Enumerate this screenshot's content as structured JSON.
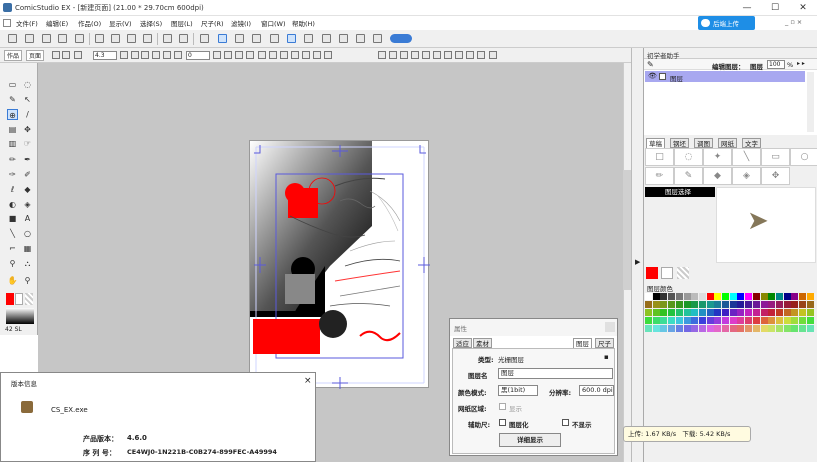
{
  "window": {
    "title": "ComicStudio EX - [新建页面] (21.00 * 29.70cm 600dpi)",
    "minimize": "—",
    "maximize": "☐",
    "close": "✕",
    "doc_restore": "_ ▫ ×"
  },
  "menu": [
    "文件(F)",
    "编辑(E)",
    "作品(O)",
    "显示(V)",
    "选择(S)",
    "图层(L)",
    "尺子(R)",
    "滤镜(I)",
    "窗口(W)",
    "帮助(H)"
  ],
  "upload_button": "后端上传",
  "toolbar2": {
    "tab1": "作品",
    "tab2": "页面",
    "zoom_value": "4.3",
    "angle_value": "0"
  },
  "tool_palette": {
    "status": "42",
    "status_unit": "SL"
  },
  "layer_panel": {
    "title": "初学者助手",
    "edit_label": "编辑图层：",
    "edit_layer": "图层",
    "opacity": "100",
    "opacity_unit": "%",
    "layer_name": "图层"
  },
  "material_panel": {
    "tabs": [
      "草稿",
      "钢坯",
      "调图",
      "网纸",
      "文字"
    ],
    "layer_select_label": "图层选择",
    "layer_color_label": "图层颜色"
  },
  "colors": {
    "primary": "#ff0000",
    "secondary": "#ffffff",
    "accent": "#1e8ee6",
    "layer_selected": "#a8a8f0"
  },
  "properties_dialog": {
    "title": "属性",
    "tabs_left": [
      "适应",
      "素材"
    ],
    "tabs_right": [
      "图层",
      "尺子"
    ],
    "type_label": "类型:",
    "type_value": "光栅图层",
    "name_label": "图层名",
    "name_value": "图层",
    "color_mode_label": "颜色模式:",
    "color_mode_value": "黑(1bit)",
    "resolution_label": "分辨率:",
    "resolution_value": "600.0 dpi",
    "grid_label": "网纸区域:",
    "grid_check": "显示",
    "aux_label": "辅助尺:",
    "aux_check1": "图层化",
    "aux_check2": "不显示",
    "detail_button": "详细显示"
  },
  "about_dialog": {
    "title": "版本信息",
    "close": "×",
    "exe": "CS_EX.exe",
    "version_label": "产品版本：",
    "version_value": "4.6.0",
    "serial_label": "序 列 号：",
    "serial_value": "CE4WJ0-1N221B-C0B274-899FEC-A49994"
  },
  "network": {
    "up_label": "上传:",
    "up_value": "1.67 KB/s",
    "down_label": "下载:",
    "down_value": "5.42 KB/s"
  }
}
